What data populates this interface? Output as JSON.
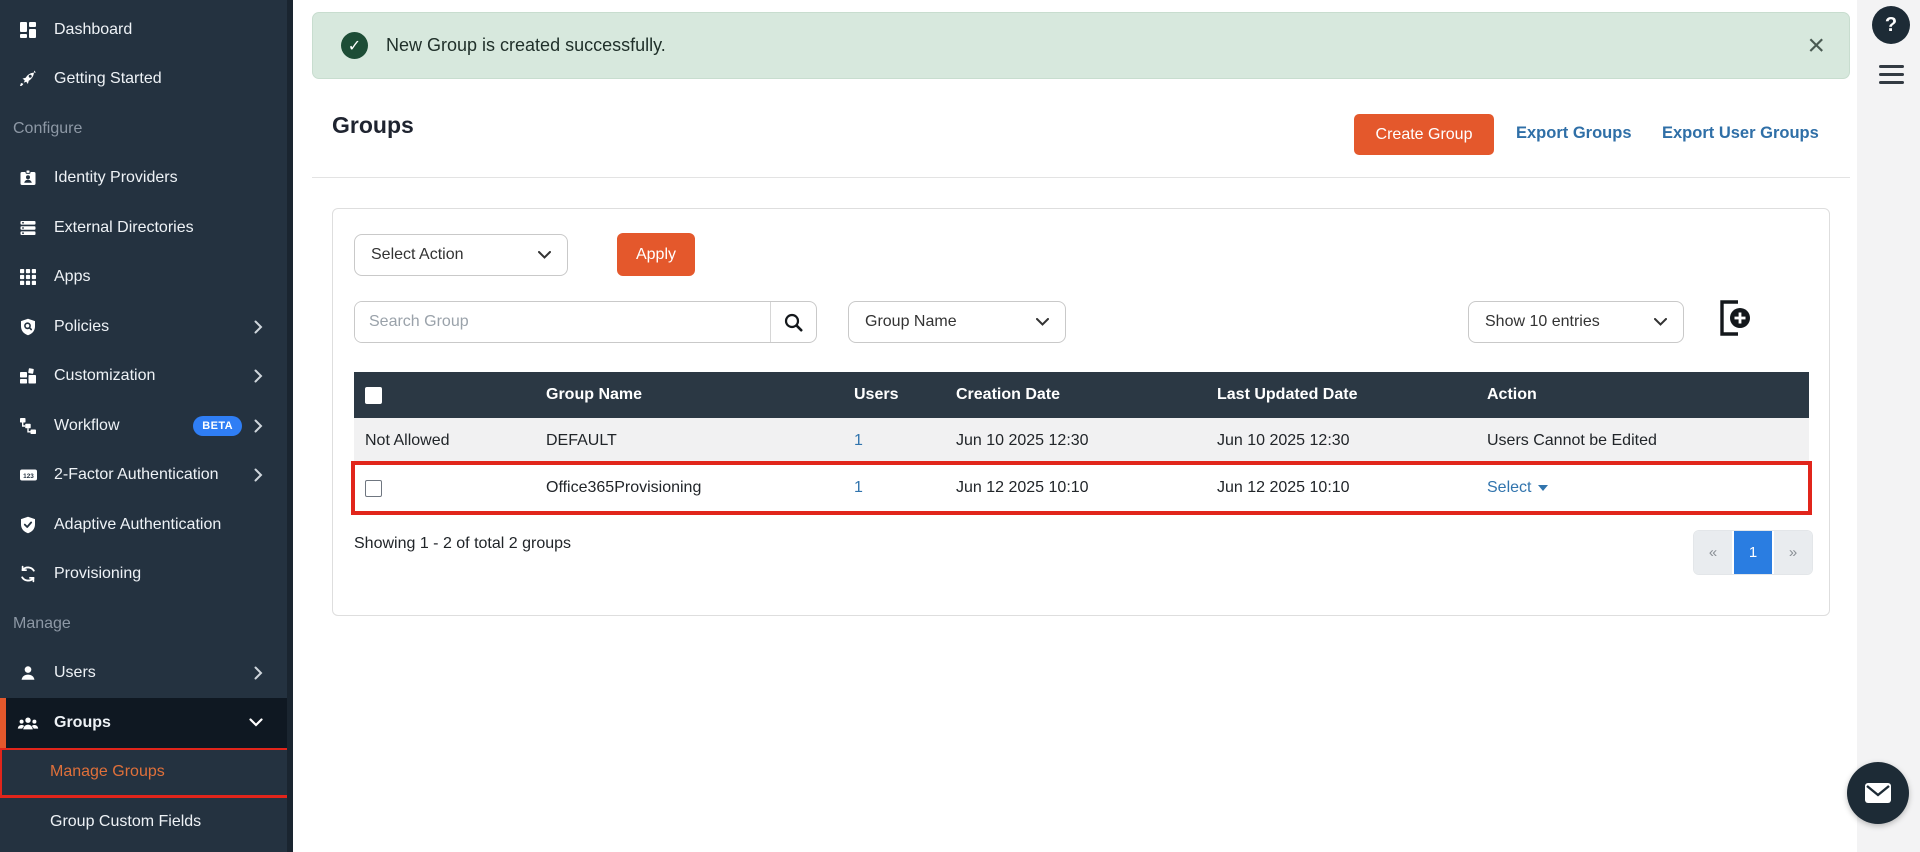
{
  "colors": {
    "sidebar_bg": "#243240",
    "sidebar_active": "#0f1822",
    "accent_orange": "#e4582c",
    "link_blue": "#3174ad",
    "beta_blue": "#2f7ef5",
    "pagination_active": "#2a7de1",
    "banner_green_bg": "#d7e8dd",
    "banner_check_green": "#1d4d36",
    "annotation_red": "#e1251b",
    "table_header_bg": "#2b3844",
    "row_alt_bg": "#f1f1f2"
  },
  "sidebar": {
    "items": [
      {
        "type": "item",
        "label": "Dashboard",
        "icon": "dashboard-icon"
      },
      {
        "type": "item",
        "label": "Getting Started",
        "icon": "rocket-icon"
      },
      {
        "type": "section",
        "label": "Configure"
      },
      {
        "type": "item",
        "label": "Identity Providers",
        "icon": "id-badge-icon"
      },
      {
        "type": "item",
        "label": "External Directories",
        "icon": "server-icon"
      },
      {
        "type": "item",
        "label": "Apps",
        "icon": "apps-grid-icon"
      },
      {
        "type": "item",
        "label": "Policies",
        "icon": "shield-search-icon",
        "chevron": "right"
      },
      {
        "type": "item",
        "label": "Customization",
        "icon": "blocks-icon",
        "chevron": "right"
      },
      {
        "type": "item",
        "label": "Workflow",
        "icon": "workflow-icon",
        "badge": "BETA",
        "chevron": "right"
      },
      {
        "type": "item",
        "label": "2-Factor Authentication",
        "icon": "numeric-123-icon",
        "chevron": "right"
      },
      {
        "type": "item",
        "label": "Adaptive Authentication",
        "icon": "shield-check-icon"
      },
      {
        "type": "item",
        "label": "Provisioning",
        "icon": "sync-icon"
      },
      {
        "type": "section",
        "label": "Manage"
      },
      {
        "type": "item",
        "label": "Users",
        "icon": "user-icon",
        "chevron": "right"
      },
      {
        "type": "item",
        "label": "Groups",
        "icon": "groups-icon",
        "chevron": "down",
        "active": true
      },
      {
        "type": "subitem",
        "label": "Manage Groups",
        "highlighted": true
      },
      {
        "type": "subitem",
        "label": "Group Custom Fields"
      }
    ]
  },
  "topbar": {
    "help_label": "?",
    "menu_icon": "hamburger-icon",
    "chat_icon": "envelope-icon"
  },
  "banner": {
    "icon": "check-circle-icon",
    "message": "New Group is created successfully.",
    "close_label": "×"
  },
  "header": {
    "title": "Groups",
    "create_button": "Create Group",
    "export_groups_link": "Export Groups",
    "export_user_groups_link": "Export User Groups"
  },
  "toolbar": {
    "select_action_value": "Select Action",
    "apply_label": "Apply",
    "search_placeholder": "Search Group",
    "search_icon": "magnifier-icon",
    "search_by_value": "Group Name",
    "show_entries_value": "Show 10 entries",
    "export_icon": "export-file-plus-icon"
  },
  "table": {
    "headers": [
      "",
      "Group Name",
      "Users",
      "Creation Date",
      "Last Updated Date",
      "Action"
    ],
    "rows": [
      {
        "has_checkbox": false,
        "first_cell": "Not Allowed",
        "group_name": "DEFAULT",
        "users": "1",
        "creation_date": "Jun 10 2025 12:30",
        "last_updated_date": "Jun 10 2025 12:30",
        "action": "Users Cannot be Edited",
        "action_type": "text",
        "highlighted": false
      },
      {
        "has_checkbox": true,
        "first_cell": "",
        "group_name": "Office365Provisioning",
        "users": "1",
        "creation_date": "Jun 12 2025 10:10",
        "last_updated_date": "Jun 12 2025 10:10",
        "action": "Select",
        "action_type": "select",
        "highlighted": true
      }
    ]
  },
  "footer": {
    "summary": "Showing 1 - 2 of total 2 groups",
    "pagination": {
      "prev": "«",
      "current": "1",
      "next": "»"
    }
  }
}
